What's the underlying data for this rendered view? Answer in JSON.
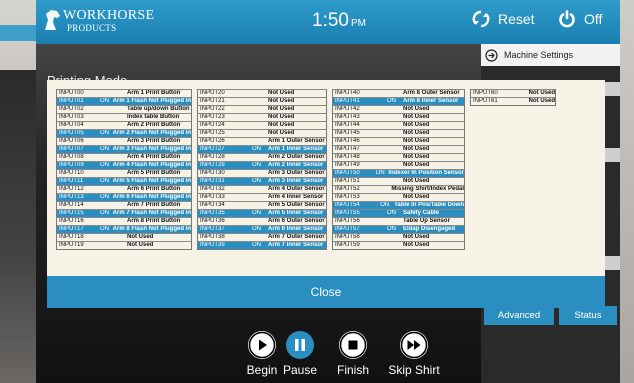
{
  "header": {
    "logo_line1": "WORKHORSE",
    "logo_line2": "PRODUCTS",
    "time": "1:50",
    "time_suffix": "PM",
    "reset_label": "Reset",
    "off_label": "Off"
  },
  "right_panel": {
    "machine_settings_label": "Machine Settings",
    "advanced_label": "Advanced",
    "status_label": "Status"
  },
  "main": {
    "title_partial": "Printing Mode"
  },
  "dialog": {
    "close_label": "Close",
    "columns": [
      [
        {
          "input": "INPUT00",
          "state": "",
          "desc": "Arm 1 Print Button",
          "on": false
        },
        {
          "input": "INPUT01",
          "state": "ON",
          "desc": "Arm 1 Flash Not Plugged In",
          "on": true
        },
        {
          "input": "INPUT02",
          "state": "",
          "desc": "Table up/down Button",
          "on": false
        },
        {
          "input": "INPUT03",
          "state": "",
          "desc": "Index table Button",
          "on": false
        },
        {
          "input": "INPUT04",
          "state": "",
          "desc": "Arm 2 Print Button",
          "on": false
        },
        {
          "input": "INPUT05",
          "state": "ON",
          "desc": "Arm 2 Flash Not Plugged In",
          "on": true
        },
        {
          "input": "INPUT06",
          "state": "",
          "desc": "Arm 3 Print Button",
          "on": false
        },
        {
          "input": "INPUT07",
          "state": "ON",
          "desc": "Arm 3 Flash Not Plugged In",
          "on": true
        },
        {
          "input": "INPUT08",
          "state": "",
          "desc": "Arm 4 Print Button",
          "on": false
        },
        {
          "input": "INPUT09",
          "state": "ON",
          "desc": "Arm 4 Flash Not Plugged In",
          "on": true
        },
        {
          "input": "INPUT10",
          "state": "",
          "desc": "Arm 5 Print Button",
          "on": false
        },
        {
          "input": "INPUT11",
          "state": "ON",
          "desc": "Arm 5 Flash Not Plugged In",
          "on": true
        },
        {
          "input": "INPUT12",
          "state": "",
          "desc": "Arm 6 Print Button",
          "on": false
        },
        {
          "input": "INPUT13",
          "state": "ON",
          "desc": "Arm 6 Flash Not Plugged In",
          "on": true
        },
        {
          "input": "INPUT14",
          "state": "",
          "desc": "Arm 7 Print Button",
          "on": false
        },
        {
          "input": "INPUT15",
          "state": "ON",
          "desc": "Arm 7 Flash Not Plugged In",
          "on": true
        },
        {
          "input": "INPUT16",
          "state": "",
          "desc": "Arm 8 Print Button",
          "on": false
        },
        {
          "input": "INPUT17",
          "state": "ON",
          "desc": "Arm 8 Flash Not Plugged In",
          "on": true
        },
        {
          "input": "INPUT18",
          "state": "",
          "desc": "Not Used",
          "on": false
        },
        {
          "input": "INPUT19",
          "state": "",
          "desc": "Not Used",
          "on": false
        }
      ],
      [
        {
          "input": "INPUT20",
          "state": "",
          "desc": "Not Used",
          "on": false
        },
        {
          "input": "INPUT21",
          "state": "",
          "desc": "Not Used",
          "on": false
        },
        {
          "input": "INPUT22",
          "state": "",
          "desc": "Not Used",
          "on": false
        },
        {
          "input": "INPUT23",
          "state": "",
          "desc": "Not Used",
          "on": false
        },
        {
          "input": "INPUT24",
          "state": "",
          "desc": "Not Used",
          "on": false
        },
        {
          "input": "INPUT25",
          "state": "",
          "desc": "Not Used",
          "on": false
        },
        {
          "input": "INPUT26",
          "state": "",
          "desc": "Arm 1 Outer Sensor",
          "on": false
        },
        {
          "input": "INPUT27",
          "state": "ON",
          "desc": "Arm 1 Inner Sensor",
          "on": true
        },
        {
          "input": "INPUT28",
          "state": "",
          "desc": "Arm 2 Outer Sensor",
          "on": false
        },
        {
          "input": "INPUT29",
          "state": "ON",
          "desc": "Arm 2 Inner Sensor",
          "on": true
        },
        {
          "input": "INPUT30",
          "state": "",
          "desc": "Arm 3 Outer Sensor",
          "on": false
        },
        {
          "input": "INPUT31",
          "state": "ON",
          "desc": "Arm 3 Inner Sensor",
          "on": true
        },
        {
          "input": "INPUT32",
          "state": "",
          "desc": "Arm 4 Outer Sensor",
          "on": false
        },
        {
          "input": "INPUT33",
          "state": "",
          "desc": "Arm 4 Inner Sensor",
          "on": false
        },
        {
          "input": "INPUT34",
          "state": "",
          "desc": "Arm 5 Outer Sensor",
          "on": false
        },
        {
          "input": "INPUT35",
          "state": "ON",
          "desc": "Arm 5 Inner Sensor",
          "on": true
        },
        {
          "input": "INPUT36",
          "state": "",
          "desc": "Arm 6 Outer Sensor",
          "on": false
        },
        {
          "input": "INPUT37",
          "state": "ON",
          "desc": "Arm 6 Inner Sensor",
          "on": true
        },
        {
          "input": "INPUT38",
          "state": "",
          "desc": "Arm 7 Outer Sensor",
          "on": false
        },
        {
          "input": "INPUT39",
          "state": "ON",
          "desc": "Arm 7 Inner Sensor",
          "on": true
        }
      ],
      [
        {
          "input": "INPUT40",
          "state": "",
          "desc": "Arm 8 Outer Sensor",
          "on": false
        },
        {
          "input": "INPUT41",
          "state": "ON",
          "desc": "Arm 8 Inner Sensor",
          "on": true
        },
        {
          "input": "INPUT42",
          "state": "",
          "desc": "Not Used",
          "on": false
        },
        {
          "input": "INPUT43",
          "state": "",
          "desc": "Not Used",
          "on": false
        },
        {
          "input": "INPUT44",
          "state": "",
          "desc": "Not Used",
          "on": false
        },
        {
          "input": "INPUT45",
          "state": "",
          "desc": "Not Used",
          "on": false
        },
        {
          "input": "INPUT46",
          "state": "",
          "desc": "Not Used",
          "on": false
        },
        {
          "input": "INPUT47",
          "state": "",
          "desc": "Not Used",
          "on": false
        },
        {
          "input": "INPUT48",
          "state": "",
          "desc": "Not Used",
          "on": false
        },
        {
          "input": "INPUT49",
          "state": "",
          "desc": "Not Used",
          "on": false
        },
        {
          "input": "INPUT50",
          "state": "ON",
          "desc": "Indexer In Position Sensor",
          "on": true
        },
        {
          "input": "INPUT51",
          "state": "",
          "desc": "Not Used",
          "on": false
        },
        {
          "input": "INPUT52",
          "state": "",
          "desc": "Missing Shirt/Index Pedal",
          "on": false
        },
        {
          "input": "INPUT53",
          "state": "",
          "desc": "Not Used",
          "on": false
        },
        {
          "input": "INPUT54",
          "state": "ON",
          "desc": "Table In Pos/Table Down",
          "on": true
        },
        {
          "input": "INPUT55",
          "state": "ON",
          "desc": "Safety Cable",
          "on": true
        },
        {
          "input": "INPUT56",
          "state": "",
          "desc": "Table Up Sensor",
          "on": false
        },
        {
          "input": "INPUT57",
          "state": "ON",
          "desc": "Eldap Disengaged",
          "on": true
        },
        {
          "input": "INPUT58",
          "state": "",
          "desc": "Not Used",
          "on": false
        },
        {
          "input": "INPUT59",
          "state": "",
          "desc": "Not Used",
          "on": false
        }
      ],
      [
        {
          "input": "INPUT60",
          "state": "",
          "desc": "Not Used",
          "on": false
        },
        {
          "input": "INPUT61",
          "state": "",
          "desc": "Not Used",
          "on": false
        }
      ]
    ]
  },
  "controls": {
    "begin_label": "Begin",
    "pause_label": "Pause",
    "finish_label": "Finish",
    "skip_label": "Skip Shirt"
  },
  "colors": {
    "accent": "#2a8fc0",
    "dialog_bg": "#f6f3e6"
  }
}
